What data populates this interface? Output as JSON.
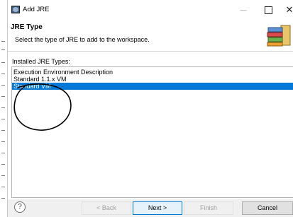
{
  "window": {
    "title": "Add JRE",
    "minimize_glyph": "—",
    "close_glyph": "✕"
  },
  "banner": {
    "title": "JRE Type",
    "description": "Select the type of JRE to add to the workspace.",
    "icon": "books-icon"
  },
  "section_label": "Installed JRE Types:",
  "jre_types": [
    {
      "label": "Execution Environment Description",
      "selected": false
    },
    {
      "label": "Standard 1.1.x VM",
      "selected": false
    },
    {
      "label": "Standard VM",
      "selected": true
    }
  ],
  "buttons": {
    "help": "?",
    "back": "< Back",
    "next": "Next >",
    "finish": "Finish",
    "cancel": "Cancel"
  },
  "colors": {
    "selection": "#0078d7",
    "annotation_ink": "#000000"
  }
}
